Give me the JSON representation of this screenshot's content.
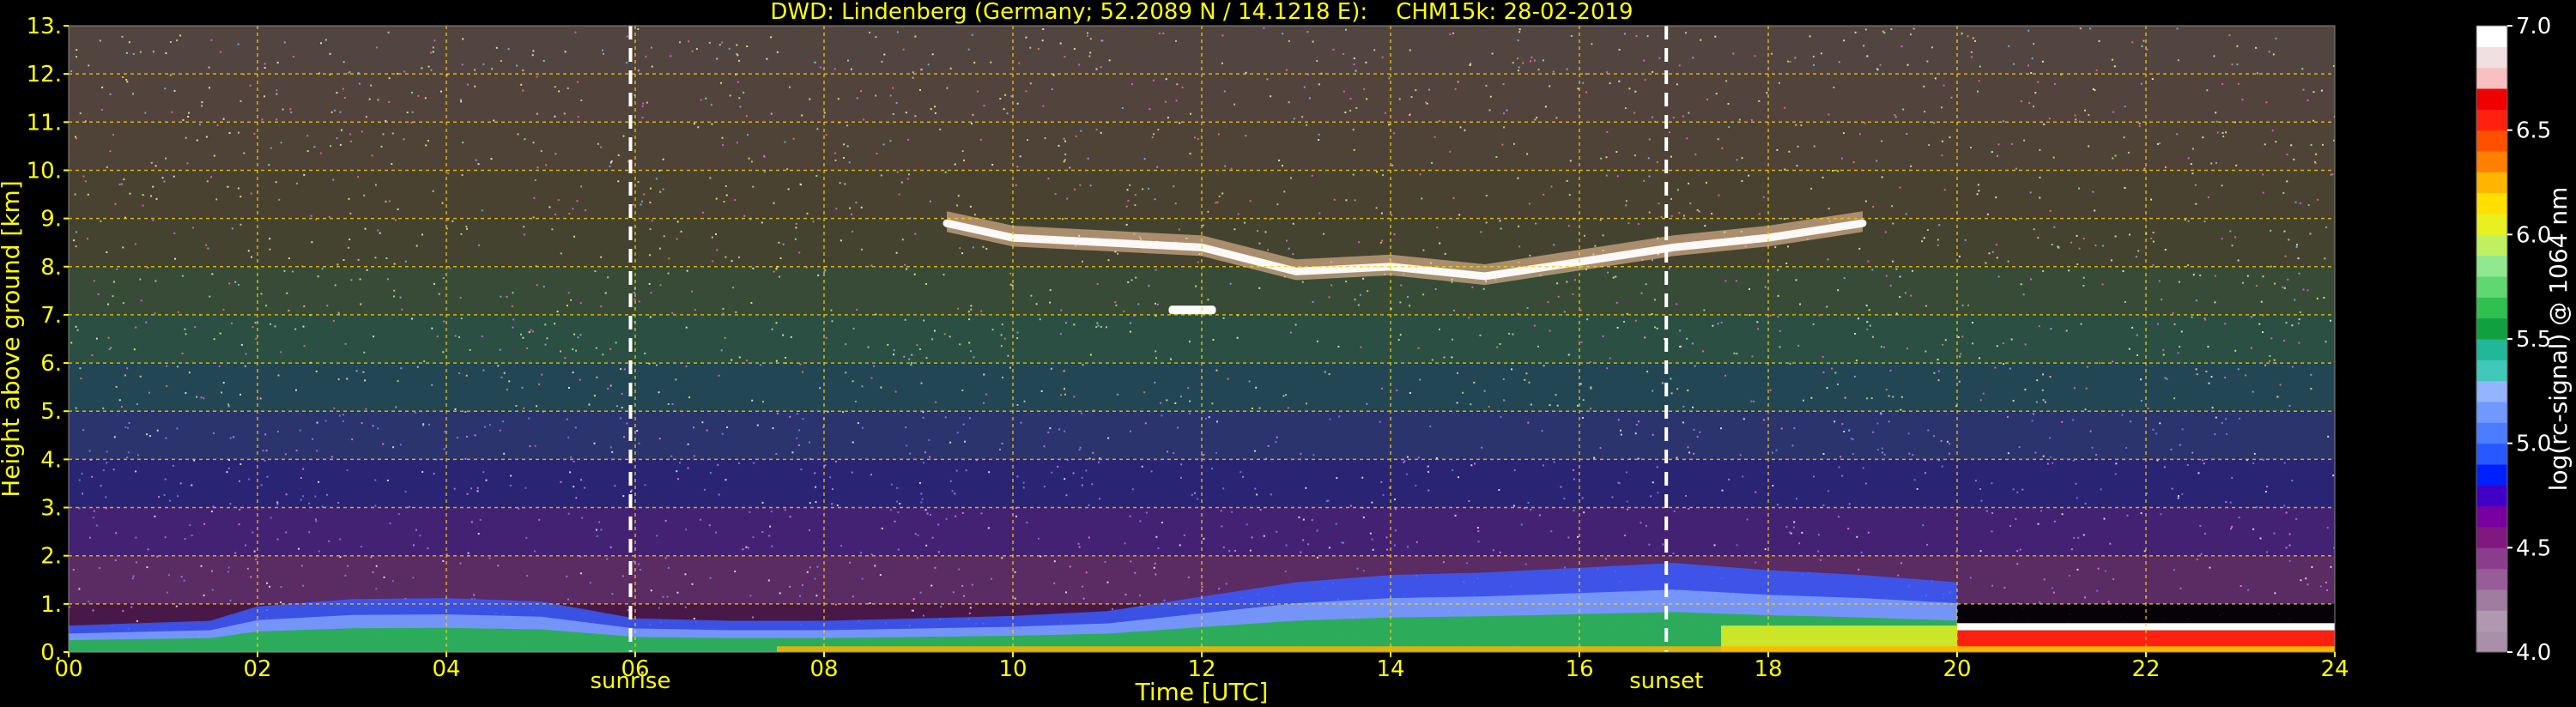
{
  "chart_data": {
    "type": "heatmap",
    "title": "DWD: Lindenberg (Germany; 52.2089 N / 14.1218 E):    CHM15k: 28-02-2019",
    "xlabel": "Time [UTC]",
    "ylabel": "Height above ground [km]",
    "xlim": [
      0,
      24
    ],
    "ylim": [
      0,
      13
    ],
    "x_ticks": [
      "00",
      "02",
      "04",
      "06",
      "08",
      "10",
      "12",
      "14",
      "16",
      "18",
      "20",
      "22",
      "24"
    ],
    "y_ticks": [
      "0.",
      "1.",
      "2.",
      "3.",
      "4.",
      "5.",
      "6.",
      "7.",
      "8.",
      "9.",
      "10.",
      "11.",
      "12.",
      "13."
    ],
    "grid": true,
    "markers": [
      {
        "label": "sunrise",
        "x": 5.95
      },
      {
        "label": "sunset",
        "x": 16.92
      }
    ],
    "colorbar": {
      "label": "log(rc-signal) @ 1064 nm",
      "range": [
        4.0,
        7.0
      ],
      "ticks": [
        "4.0",
        "4.5",
        "5.0",
        "5.5",
        "6.0",
        "6.5",
        "7.0"
      ],
      "colors": [
        "#a890a8",
        "#b098b0",
        "#a07ca0",
        "#985c98",
        "#8c3c8c",
        "#801880",
        "#7800a0",
        "#4000c8",
        "#0020ff",
        "#2858ff",
        "#4c7cff",
        "#7098ff",
        "#94b4ff",
        "#40c8b8",
        "#20b898",
        "#10a040",
        "#30c050",
        "#60d870",
        "#90e890",
        "#c0f060",
        "#e8f020",
        "#ffe000",
        "#ffb400",
        "#ff8000",
        "#ff5000",
        "#ff2010",
        "#f00000",
        "#f8c0c0",
        "#f0e0e0",
        "#ffffff"
      ]
    },
    "layers": {
      "boundary_layer_top_km": [
        [
          0.0,
          0.55
        ],
        [
          1.5,
          0.65
        ],
        [
          2.0,
          0.95
        ],
        [
          3.0,
          1.1
        ],
        [
          4.0,
          1.12
        ],
        [
          5.0,
          1.05
        ],
        [
          6.0,
          0.7
        ],
        [
          7.0,
          0.65
        ],
        [
          8.0,
          0.65
        ],
        [
          9.0,
          0.7
        ],
        [
          10.0,
          0.75
        ],
        [
          11.0,
          0.85
        ],
        [
          12.0,
          1.15
        ],
        [
          13.0,
          1.45
        ],
        [
          14.0,
          1.6
        ],
        [
          15.0,
          1.65
        ],
        [
          16.0,
          1.75
        ],
        [
          17.0,
          1.85
        ],
        [
          18.0,
          1.7
        ],
        [
          19.0,
          1.6
        ],
        [
          20.0,
          1.45
        ]
      ],
      "cirrus_cloud_km": [
        [
          9.3,
          8.9
        ],
        [
          10.0,
          8.6
        ],
        [
          11.0,
          8.5
        ],
        [
          12.0,
          8.4
        ],
        [
          13.0,
          7.9
        ],
        [
          14.0,
          8.0
        ],
        [
          15.0,
          7.8
        ],
        [
          16.0,
          8.1
        ],
        [
          17.0,
          8.4
        ],
        [
          18.0,
          8.6
        ],
        [
          19.0,
          8.9
        ]
      ],
      "small_cloud": {
        "x": [
          11.65,
          12.15
        ],
        "height_km": 7.1
      },
      "night_surface_layer": {
        "x": [
          20.0,
          24.0
        ],
        "height_km": [
          0.0,
          0.6
        ]
      }
    }
  }
}
